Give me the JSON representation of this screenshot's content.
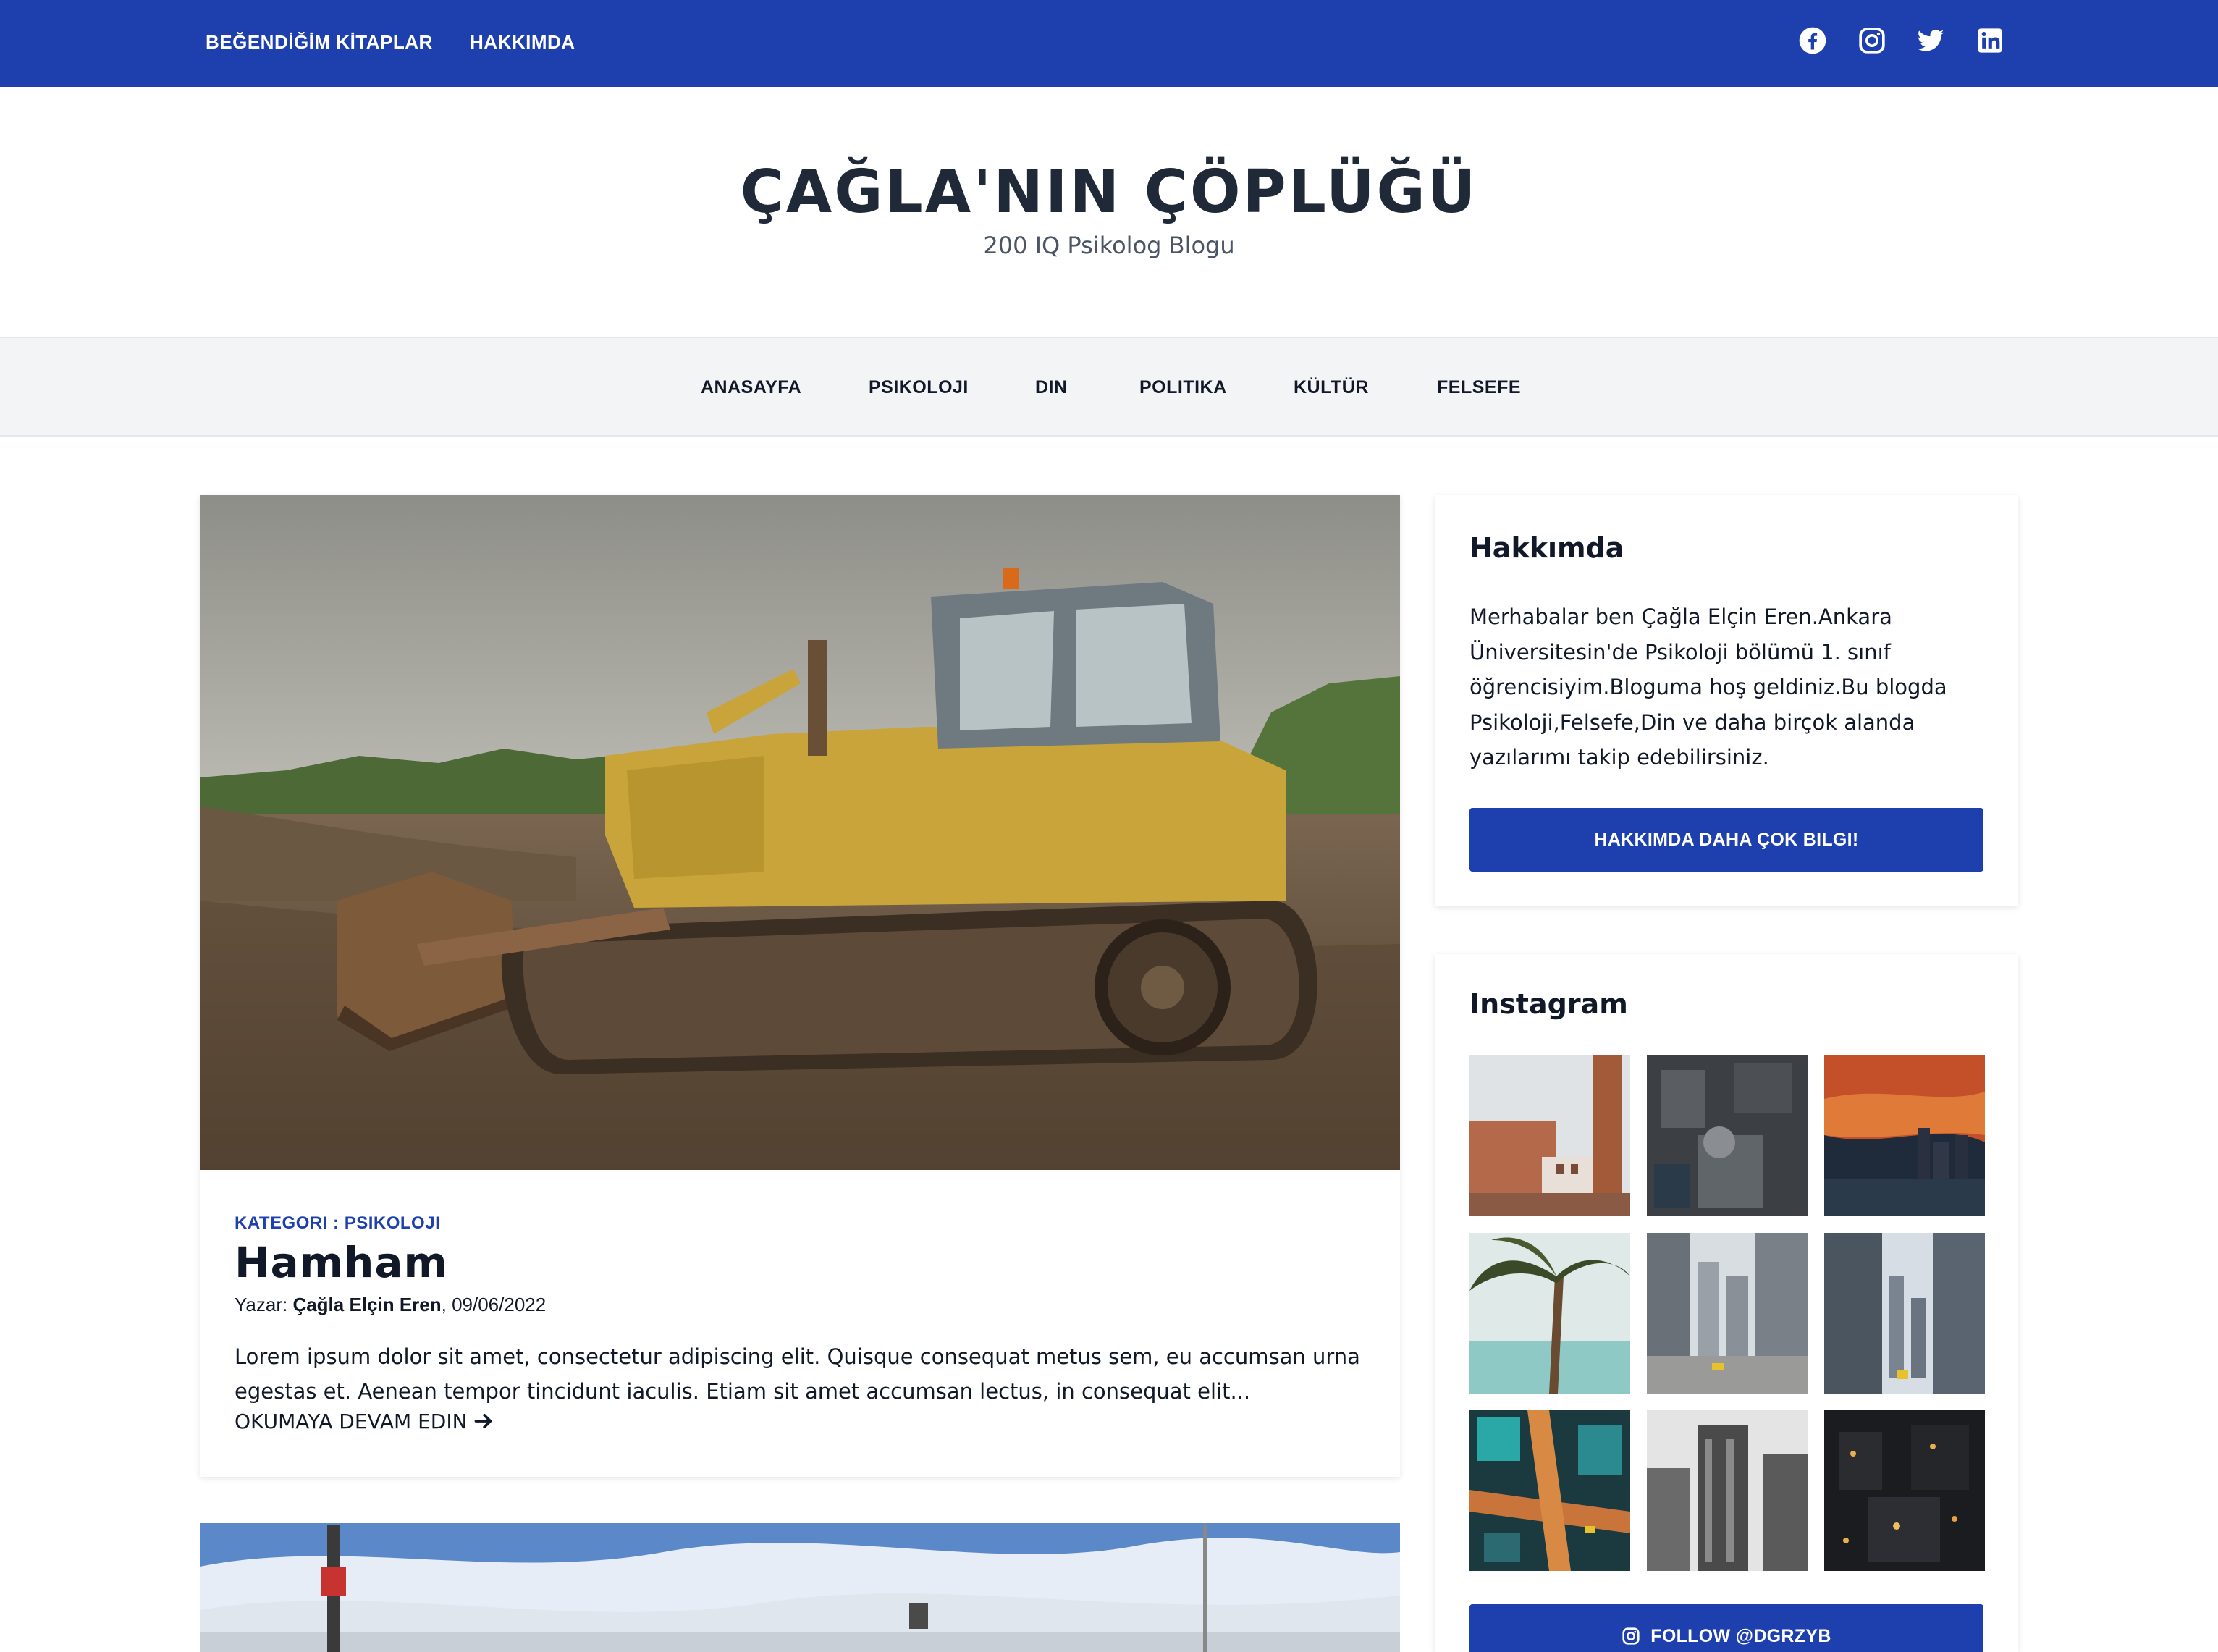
{
  "topnav": {
    "links": [
      "BEĞENDİĞİM KİTAPLAR",
      "HAKKIMDA"
    ],
    "social_icons": [
      "facebook-icon",
      "instagram-icon",
      "twitter-icon",
      "linkedin-icon"
    ]
  },
  "header": {
    "title": "ÇAĞLA'NIN ÇÖPLÜĞÜ",
    "tagline": "200 IQ Psikolog Blogu"
  },
  "catnav": {
    "items": [
      "ANASAYFA",
      "PSIKOLOJI",
      "DIN",
      "POLITIKA",
      "KÜLTÜR",
      "FELSEFE"
    ]
  },
  "post": {
    "category": "KATEGORI : PSIKOLOJI",
    "title": "Hamham",
    "author_prefix": "Yazar: ",
    "author": "Çağla Elçin Eren",
    "date": ", 09/06/2022",
    "excerpt": "Lorem ipsum dolor sit amet, consectetur adipiscing elit. Quisque consequat metus sem, eu accumsan urna egestas et. Aenean tempor tincidunt iaculis. Etiam sit amet accumsan lectus, in consequat elit...",
    "read_more": "OKUMAYA DEVAM EDIN",
    "read_more_icon": "arrow-right-icon"
  },
  "sidebar": {
    "about": {
      "title": "Hakkımda",
      "text": "Merhabalar ben Çağla Elçin Eren.Ankara Üniversitesin'de Psikoloji bölümü 1. sınıf öğrencisiyim.Bloguma hoş geldiniz.Bu blogda Psikoloji,Felsefe,Din ve daha birçok alanda yazılarımı takip edebilirsiniz.",
      "button": "HAKKIMDA DAHA ÇOK BILGI!"
    },
    "instagram": {
      "title": "Instagram",
      "follow_button": "FOLLOW @DGRZYB"
    }
  },
  "colors": {
    "brand": "#1e40af",
    "nav_bg": "#f3f4f6",
    "text": "#111827"
  }
}
